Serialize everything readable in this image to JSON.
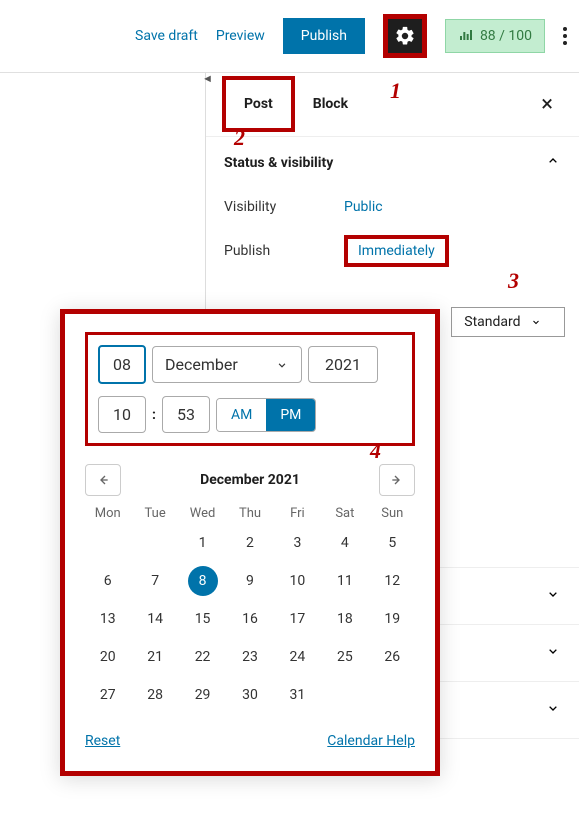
{
  "toolbar": {
    "save": "Save draft",
    "preview": "Preview",
    "publish": "Publish",
    "score": "88 / 100"
  },
  "annotations": {
    "a1": "1",
    "a2": "2",
    "a3": "3",
    "a4": "4"
  },
  "tabs": {
    "post": "Post",
    "block": "Block"
  },
  "status": {
    "title": "Status & visibility",
    "visibility_label": "Visibility",
    "visibility_value": "Public",
    "publish_label": "Publish",
    "publish_value": "Immediately",
    "format": "Standard"
  },
  "datetime": {
    "day": "08",
    "month": "December",
    "year": "2021",
    "hour": "10",
    "minute": "53",
    "am": "AM",
    "pm": "PM",
    "selected_meridiem": "PM"
  },
  "calendar": {
    "title": "December 2021",
    "headers": [
      "Mon",
      "Tue",
      "Wed",
      "Thu",
      "Fri",
      "Sat",
      "Sun"
    ],
    "weeks": [
      [
        "",
        "",
        "1",
        "2",
        "3",
        "4",
        "5"
      ],
      [
        "6",
        "7",
        "8",
        "9",
        "10",
        "11",
        "12"
      ],
      [
        "13",
        "14",
        "15",
        "16",
        "17",
        "18",
        "19"
      ],
      [
        "20",
        "21",
        "22",
        "23",
        "24",
        "25",
        "26"
      ],
      [
        "27",
        "28",
        "29",
        "30",
        "31",
        "",
        ""
      ]
    ],
    "selected": "8",
    "reset": "Reset",
    "help": "Calendar Help"
  }
}
